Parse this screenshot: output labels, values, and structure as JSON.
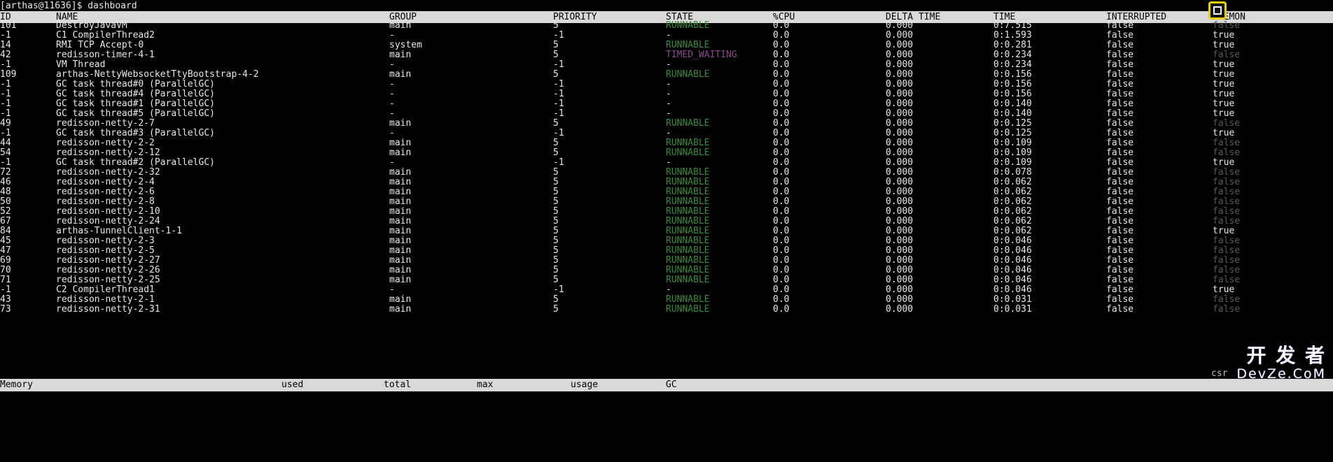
{
  "prompt": "[arthas@11636]$ dashboard",
  "columns": {
    "id": "ID",
    "name": "NAME",
    "group": "GROUP",
    "priority": "PRIORITY",
    "state": "STATE",
    "cpu": "%CPU",
    "delta_time": "DELTA TIME",
    "time": "TIME",
    "interrupted": "INTERRUPTED",
    "daemon": "DAEMON"
  },
  "threads": [
    {
      "id": "101",
      "name": "DestroyJavaVM",
      "group": "main",
      "priority": "5",
      "state": "RUNNABLE",
      "cpu": "0.0",
      "delta": "0.000",
      "time": "0:7.515",
      "interrupted": "false",
      "daemon": "false"
    },
    {
      "id": "-1",
      "name": "C1 CompilerThread2",
      "group": "-",
      "priority": "-1",
      "state": "-",
      "cpu": "0.0",
      "delta": "0.000",
      "time": "0:1.593",
      "interrupted": "false",
      "daemon": "true"
    },
    {
      "id": "14",
      "name": "RMI TCP Accept-0",
      "group": "system",
      "priority": "5",
      "state": "RUNNABLE",
      "cpu": "0.0",
      "delta": "0.000",
      "time": "0:0.281",
      "interrupted": "false",
      "daemon": "true"
    },
    {
      "id": "42",
      "name": "redisson-timer-4-1",
      "group": "main",
      "priority": "5",
      "state": "TIMED_WAITING",
      "cpu": "0.0",
      "delta": "0.000",
      "time": "0:0.234",
      "interrupted": "false",
      "daemon": "false"
    },
    {
      "id": "-1",
      "name": "VM Thread",
      "group": "-",
      "priority": "-1",
      "state": "-",
      "cpu": "0.0",
      "delta": "0.000",
      "time": "0:0.234",
      "interrupted": "false",
      "daemon": "true"
    },
    {
      "id": "109",
      "name": "arthas-NettyWebsocketTtyBootstrap-4-2",
      "group": "main",
      "priority": "5",
      "state": "RUNNABLE",
      "cpu": "0.0",
      "delta": "0.000",
      "time": "0:0.156",
      "interrupted": "false",
      "daemon": "true"
    },
    {
      "id": "-1",
      "name": "GC task thread#0 (ParallelGC)",
      "group": "-",
      "priority": "-1",
      "state": "-",
      "cpu": "0.0",
      "delta": "0.000",
      "time": "0:0.156",
      "interrupted": "false",
      "daemon": "true"
    },
    {
      "id": "-1",
      "name": "GC task thread#4 (ParallelGC)",
      "group": "-",
      "priority": "-1",
      "state": "-",
      "cpu": "0.0",
      "delta": "0.000",
      "time": "0:0.156",
      "interrupted": "false",
      "daemon": "true"
    },
    {
      "id": "-1",
      "name": "GC task thread#1 (ParallelGC)",
      "group": "-",
      "priority": "-1",
      "state": "-",
      "cpu": "0.0",
      "delta": "0.000",
      "time": "0:0.140",
      "interrupted": "false",
      "daemon": "true"
    },
    {
      "id": "-1",
      "name": "GC task thread#5 (ParallelGC)",
      "group": "-",
      "priority": "-1",
      "state": "-",
      "cpu": "0.0",
      "delta": "0.000",
      "time": "0:0.140",
      "interrupted": "false",
      "daemon": "true"
    },
    {
      "id": "49",
      "name": "redisson-netty-2-7",
      "group": "main",
      "priority": "5",
      "state": "RUNNABLE",
      "cpu": "0.0",
      "delta": "0.000",
      "time": "0:0.125",
      "interrupted": "false",
      "daemon": "false"
    },
    {
      "id": "-1",
      "name": "GC task thread#3 (ParallelGC)",
      "group": "-",
      "priority": "-1",
      "state": "-",
      "cpu": "0.0",
      "delta": "0.000",
      "time": "0:0.125",
      "interrupted": "false",
      "daemon": "true"
    },
    {
      "id": "44",
      "name": "redisson-netty-2-2",
      "group": "main",
      "priority": "5",
      "state": "RUNNABLE",
      "cpu": "0.0",
      "delta": "0.000",
      "time": "0:0.109",
      "interrupted": "false",
      "daemon": "false"
    },
    {
      "id": "54",
      "name": "redisson-netty-2-12",
      "group": "main",
      "priority": "5",
      "state": "RUNNABLE",
      "cpu": "0.0",
      "delta": "0.000",
      "time": "0:0.109",
      "interrupted": "false",
      "daemon": "false"
    },
    {
      "id": "-1",
      "name": "GC task thread#2 (ParallelGC)",
      "group": "-",
      "priority": "-1",
      "state": "-",
      "cpu": "0.0",
      "delta": "0.000",
      "time": "0:0.109",
      "interrupted": "false",
      "daemon": "true"
    },
    {
      "id": "72",
      "name": "redisson-netty-2-32",
      "group": "main",
      "priority": "5",
      "state": "RUNNABLE",
      "cpu": "0.0",
      "delta": "0.000",
      "time": "0:0.078",
      "interrupted": "false",
      "daemon": "false"
    },
    {
      "id": "46",
      "name": "redisson-netty-2-4",
      "group": "main",
      "priority": "5",
      "state": "RUNNABLE",
      "cpu": "0.0",
      "delta": "0.000",
      "time": "0:0.062",
      "interrupted": "false",
      "daemon": "false"
    },
    {
      "id": "48",
      "name": "redisson-netty-2-6",
      "group": "main",
      "priority": "5",
      "state": "RUNNABLE",
      "cpu": "0.0",
      "delta": "0.000",
      "time": "0:0.062",
      "interrupted": "false",
      "daemon": "false"
    },
    {
      "id": "50",
      "name": "redisson-netty-2-8",
      "group": "main",
      "priority": "5",
      "state": "RUNNABLE",
      "cpu": "0.0",
      "delta": "0.000",
      "time": "0:0.062",
      "interrupted": "false",
      "daemon": "false"
    },
    {
      "id": "52",
      "name": "redisson-netty-2-10",
      "group": "main",
      "priority": "5",
      "state": "RUNNABLE",
      "cpu": "0.0",
      "delta": "0.000",
      "time": "0:0.062",
      "interrupted": "false",
      "daemon": "false"
    },
    {
      "id": "67",
      "name": "redisson-netty-2-24",
      "group": "main",
      "priority": "5",
      "state": "RUNNABLE",
      "cpu": "0.0",
      "delta": "0.000",
      "time": "0:0.062",
      "interrupted": "false",
      "daemon": "false"
    },
    {
      "id": "84",
      "name": "arthas-TunnelClient-1-1",
      "group": "main",
      "priority": "5",
      "state": "RUNNABLE",
      "cpu": "0.0",
      "delta": "0.000",
      "time": "0:0.062",
      "interrupted": "false",
      "daemon": "true"
    },
    {
      "id": "45",
      "name": "redisson-netty-2-3",
      "group": "main",
      "priority": "5",
      "state": "RUNNABLE",
      "cpu": "0.0",
      "delta": "0.000",
      "time": "0:0.046",
      "interrupted": "false",
      "daemon": "false"
    },
    {
      "id": "47",
      "name": "redisson-netty-2-5",
      "group": "main",
      "priority": "5",
      "state": "RUNNABLE",
      "cpu": "0.0",
      "delta": "0.000",
      "time": "0:0.046",
      "interrupted": "false",
      "daemon": "false"
    },
    {
      "id": "69",
      "name": "redisson-netty-2-27",
      "group": "main",
      "priority": "5",
      "state": "RUNNABLE",
      "cpu": "0.0",
      "delta": "0.000",
      "time": "0:0.046",
      "interrupted": "false",
      "daemon": "false"
    },
    {
      "id": "70",
      "name": "redisson-netty-2-26",
      "group": "main",
      "priority": "5",
      "state": "RUNNABLE",
      "cpu": "0.0",
      "delta": "0.000",
      "time": "0:0.046",
      "interrupted": "false",
      "daemon": "false"
    },
    {
      "id": "71",
      "name": "redisson-netty-2-25",
      "group": "main",
      "priority": "5",
      "state": "RUNNABLE",
      "cpu": "0.0",
      "delta": "0.000",
      "time": "0:0.046",
      "interrupted": "false",
      "daemon": "false"
    },
    {
      "id": "-1",
      "name": "C2 CompilerThread1",
      "group": "-",
      "priority": "-1",
      "state": "-",
      "cpu": "0.0",
      "delta": "0.000",
      "time": "0:0.046",
      "interrupted": "false",
      "daemon": "true"
    },
    {
      "id": "43",
      "name": "redisson-netty-2-1",
      "group": "main",
      "priority": "5",
      "state": "RUNNABLE",
      "cpu": "0.0",
      "delta": "0.000",
      "time": "0:0.031",
      "interrupted": "false",
      "daemon": "false"
    },
    {
      "id": "73",
      "name": "redisson-netty-2-31",
      "group": "main",
      "priority": "5",
      "state": "RUNNABLE",
      "cpu": "0.0",
      "delta": "0.000",
      "time": "0:0.031",
      "interrupted": "false",
      "daemon": "false"
    }
  ],
  "memory_header": {
    "memory": "Memory",
    "used": "used",
    "total": "total",
    "max": "max",
    "usage": "usage",
    "gc": "GC"
  },
  "watermark": {
    "top": "开 发 者",
    "bottom": "DevZe.CoM",
    "prefix": "csr"
  },
  "colors": {
    "runnable": "#3a8a3a",
    "timed_waiting": "#8a4a8a",
    "daemon_false": "#5a5a5a",
    "header_bg": "#d9d9d9",
    "focus_icon": "#e6d000"
  },
  "icons": {
    "focus": "focus-frame-icon"
  }
}
